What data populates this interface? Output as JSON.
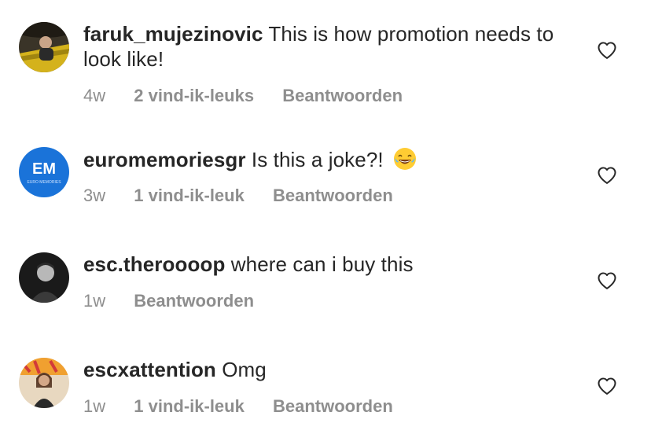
{
  "comments": [
    {
      "username": "faruk_mujezinovic",
      "text": " This is how promotion needs to look like!",
      "time": "4w",
      "likes": "2 vind-ik-leuks",
      "reply": "Beantwoorden",
      "avatar": "photo-person-yellow-car"
    },
    {
      "username": "euromemoriesgr",
      "text": " Is this a joke?!",
      "emoji": "face-with-tears-of-joy",
      "time": "3w",
      "likes": "1 vind-ik-leuk",
      "reply": "Beantwoorden",
      "avatar_text": "EM",
      "avatar_subtext": "EURO MEMORIES",
      "avatar_color": "#1a73d9"
    },
    {
      "username": "esc.theroooop",
      "text": " where can i buy this",
      "time": "1w",
      "reply": "Beantwoorden",
      "avatar": "photo-person-dark"
    },
    {
      "username": "escxattention",
      "text": " Omg",
      "time": "1w",
      "likes": "1 vind-ik-leuk",
      "reply": "Beantwoorden",
      "avatar": "photo-person-colorful"
    }
  ],
  "icons": {
    "like": "heart-outline-icon"
  },
  "colors": {
    "text": "#262626",
    "meta": "#8e8e8e"
  }
}
